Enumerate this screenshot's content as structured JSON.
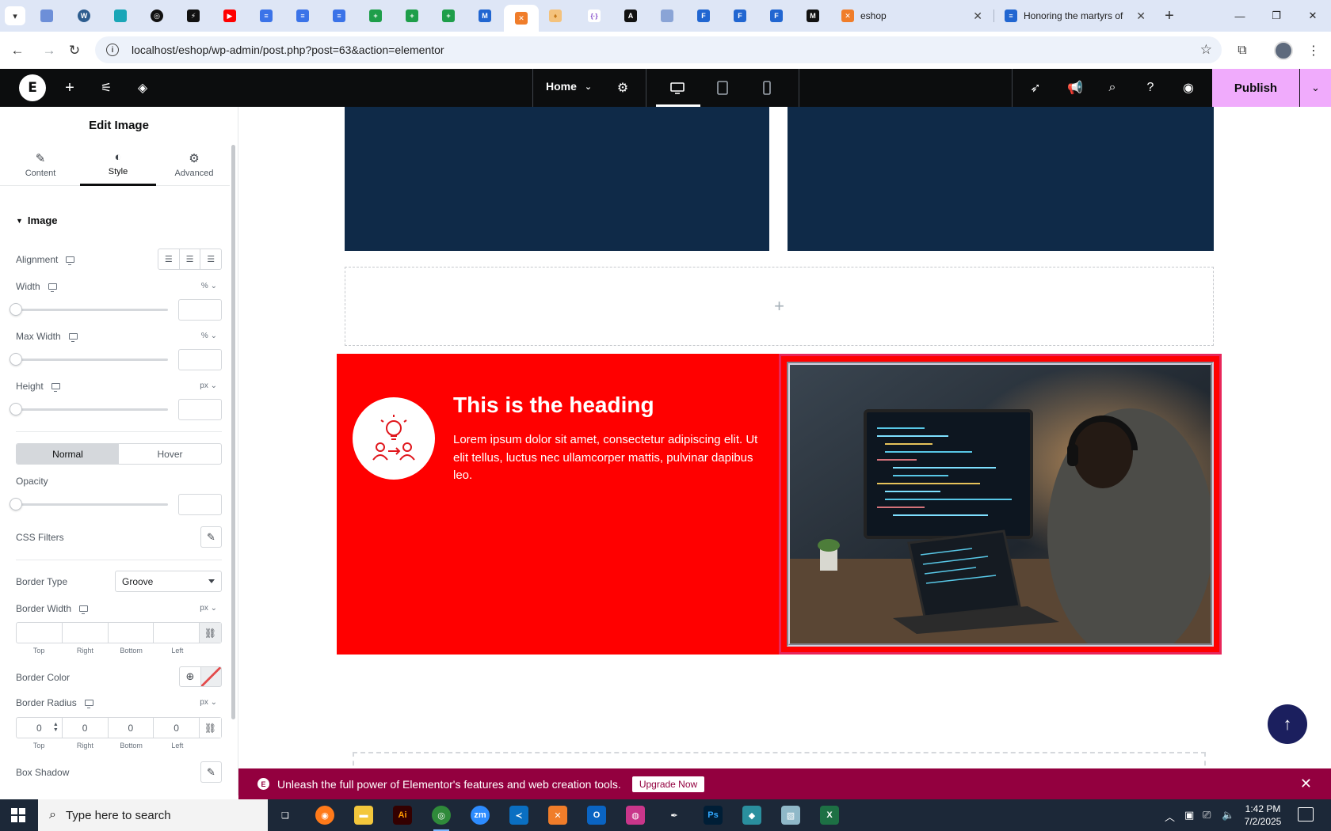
{
  "browser": {
    "tabs": [
      {
        "title": "eshop"
      },
      {
        "title": "Honoring the martyrs of"
      }
    ],
    "url": "localhost/eshop/wp-admin/post.php?post=63&action=elementor"
  },
  "editor": {
    "page_name": "Home",
    "publish_label": "Publish"
  },
  "panel": {
    "title": "Edit Image",
    "tabs": [
      {
        "label": "Content",
        "icon": "pencil-icon"
      },
      {
        "label": "Style",
        "icon": "contrast-icon"
      },
      {
        "label": "Advanced",
        "icon": "gear-icon"
      }
    ],
    "section": "Image",
    "controls": {
      "alignment": "Alignment",
      "width": "Width",
      "width_unit": "%",
      "max_width": "Max Width",
      "max_width_unit": "%",
      "height": "Height",
      "height_unit": "px",
      "normal": "Normal",
      "hover": "Hover",
      "opacity": "Opacity",
      "css_filters": "CSS Filters",
      "border_type": "Border Type",
      "border_type_value": "Groove",
      "border_width": "Border Width",
      "border_width_unit": "px",
      "border_color": "Border Color",
      "border_radius": "Border Radius",
      "border_radius_unit": "px",
      "box_shadow": "Box Shadow"
    },
    "dim_labels": [
      "Top",
      "Right",
      "Bottom",
      "Left"
    ],
    "radius_values": [
      "0",
      "0",
      "0",
      "0"
    ]
  },
  "canvas": {
    "heading": "This is the heading",
    "paragraph": "Lorem ipsum dolor sit amet, consectetur adipiscing elit. Ut elit tellus, luctus nec ullamcorper mattis, pulvinar dapibus leo."
  },
  "notice": {
    "text": "Unleash the full power of Elementor's features and web creation tools.",
    "button": "Upgrade Now"
  },
  "taskbar": {
    "search_placeholder": "Type here to search",
    "time": "1:42 PM",
    "date": "7/2/2025"
  },
  "colors": {
    "accent": "#f0abfc",
    "section_red": "#ff0000",
    "navy": "#0f2a48",
    "notice": "#93003f",
    "selection": "#e8265a"
  }
}
